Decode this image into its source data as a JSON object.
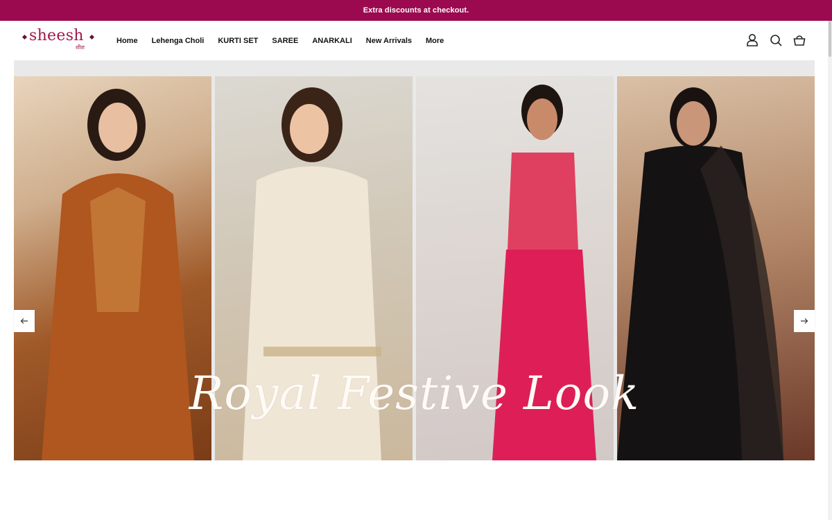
{
  "announcement": "Extra discounts at checkout.",
  "logo": {
    "name": "sheesh",
    "subtitle": "शीश"
  },
  "nav": [
    "Home",
    "Lehenga Choli",
    "KURTI SET",
    "SAREE",
    "ANARKALI",
    "New Arrivals",
    "More"
  ],
  "header_icons": [
    "account-icon",
    "search-icon",
    "cart-icon"
  ],
  "hero": {
    "title": "Royal Festive Look",
    "panels": [
      "rust-orange-sharara-suit",
      "ivory-mirror-work-suit",
      "pink-floral-co-ord-set",
      "black-sequin-anarkali"
    ]
  },
  "slider_controls": {
    "prev": "arrow-left-icon",
    "next": "arrow-right-icon"
  },
  "colors": {
    "accent": "#9b0a4f",
    "brand": "#a0184a"
  }
}
